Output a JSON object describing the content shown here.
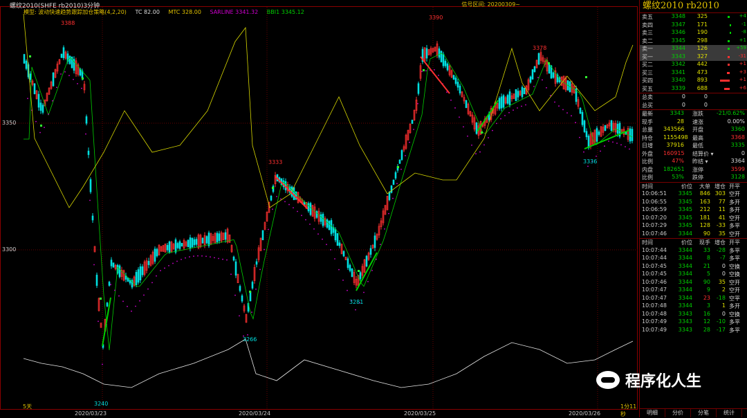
{
  "window_title": "螺纹2010(SHFE  rb2010)3分钟",
  "signal_range": "信号区间: 20200309~",
  "indicators": {
    "model": "模型: 波动快速趋势跟踪加仓策略(4,2,20)",
    "tc": "TC 82.00",
    "mtc": "MTC 328.00",
    "sarline": "SARLINE 3341.32",
    "bbi": "BBI1 3345.12"
  },
  "colors": {
    "up": "#ff3030",
    "down": "#00e0e0",
    "ma": "#00d000",
    "mtc": "#d8d800",
    "sar": "#d000d0",
    "vol": "#e8e8e8",
    "grid": "#6a0000"
  },
  "y_axis": [
    "3350",
    "3300"
  ],
  "x_axis": [
    "2020/03/23",
    "2020/03/24",
    "2020/03/25",
    "2020/03/26"
  ],
  "price_labels": [
    "3388",
    "3240",
    "3266",
    "3333",
    "3281",
    "3390",
    "3378",
    "3336"
  ],
  "bottom_left": "5天",
  "bottom_right": "1分11秒",
  "panel": {
    "title": "螺纹2010  rb2010",
    "orderbook": [
      {
        "label": "卖五",
        "price": "3348",
        "vol": "325",
        "chg": "+4",
        "bar": 3,
        "color": "#00d000",
        "hl": false
      },
      {
        "label": "卖四",
        "price": "3347",
        "vol": "171",
        "chg": "-1",
        "bar": 0,
        "color": "#00d000",
        "hl": false
      },
      {
        "label": "卖三",
        "price": "3346",
        "vol": "190",
        "chg": "-8",
        "bar": 0,
        "color": "#00d000",
        "hl": false
      },
      {
        "label": "卖二",
        "price": "3345",
        "vol": "298",
        "chg": "+1",
        "bar": 3,
        "color": "#00d000",
        "hl": false
      },
      {
        "label": "卖一",
        "price": "3344",
        "vol": "126",
        "chg": "+59",
        "bar": 3,
        "color": "#00d000",
        "hl": true
      },
      {
        "label": "买一",
        "price": "3343",
        "vol": "327",
        "chg": "-31",
        "bar": 3,
        "color": "#ff3030",
        "hl": true
      },
      {
        "label": "买二",
        "price": "3342",
        "vol": "442",
        "chg": "+1",
        "bar": 3,
        "color": "#ff3030",
        "hl": false
      },
      {
        "label": "买三",
        "price": "3341",
        "vol": "473",
        "chg": "+3",
        "bar": 4,
        "color": "#ff3030",
        "hl": false
      },
      {
        "label": "买四",
        "price": "3340",
        "vol": "893",
        "chg": "+1",
        "bar": 14,
        "color": "#ff3030",
        "hl": false
      },
      {
        "label": "买五",
        "price": "3339",
        "vol": "688",
        "chg": "+6",
        "bar": 8,
        "color": "#ff3030",
        "hl": false
      }
    ],
    "totals": [
      {
        "label": "总卖",
        "v1": "0",
        "v2": "0"
      },
      {
        "label": "总买",
        "v1": "0",
        "v2": "0"
      }
    ],
    "stats": [
      {
        "k1": "最新",
        "v1": "3343",
        "c1": "#00d000",
        "k2": "涨跌",
        "v2": "-21/0.62%",
        "c2": "#00d000"
      },
      {
        "k1": "现手",
        "v1": "28",
        "c1": "#e0e000",
        "k2": "速涨",
        "v2": "0.00%",
        "c2": "#ddd"
      },
      {
        "k1": "总量",
        "v1": "343566",
        "c1": "#e0e000",
        "k2": "开盘",
        "v2": "3360",
        "c2": "#00d000"
      },
      {
        "k1": "持仓",
        "v1": "1155498",
        "c1": "#e0e000",
        "k2": "最高",
        "v2": "3368",
        "c2": "#ff3030"
      },
      {
        "k1": "日增",
        "v1": "37916",
        "c1": "#e0e000",
        "k2": "最低",
        "v2": "3335",
        "c2": "#00d000"
      },
      {
        "k1": "外盘",
        "v1": "160915",
        "c1": "#ff3030",
        "k2": "结算价 ▾",
        "v2": "0",
        "c2": "#ddd"
      },
      {
        "k1": "比例",
        "v1": "47%",
        "c1": "#ff3030",
        "k2": "昨结 ▾",
        "v2": "3364",
        "c2": "#ddd"
      },
      {
        "k1": "内盘",
        "v1": "182651",
        "c1": "#00d000",
        "k2": "涨停",
        "v2": "3599",
        "c2": "#ff3030"
      },
      {
        "k1": "比例",
        "v1": "53%",
        "c1": "#00d000",
        "k2": "跌停",
        "v2": "3128",
        "c2": "#00d000"
      }
    ],
    "ticks1_header": [
      "时间",
      "价位",
      "大单",
      "增仓",
      "开平"
    ],
    "ticks1": [
      {
        "t": "10:06:51",
        "p": "3345",
        "v": "846",
        "d": "303",
        "n": "空开",
        "pc": "#00d000",
        "dc": "#e0e000"
      },
      {
        "t": "10:06:55",
        "p": "3345",
        "v": "163",
        "d": "77",
        "n": "多开",
        "pc": "#00d000",
        "dc": "#e0e000"
      },
      {
        "t": "10:06:59",
        "p": "3345",
        "v": "212",
        "d": "11",
        "n": "多开",
        "pc": "#00d000",
        "dc": "#e0e000"
      },
      {
        "t": "10:07:20",
        "p": "3345",
        "v": "181",
        "d": "41",
        "n": "空开",
        "pc": "#00d000",
        "dc": "#e0e000"
      },
      {
        "t": "10:07:29",
        "p": "3345",
        "v": "128",
        "d": "-33",
        "n": "多平",
        "pc": "#00d000",
        "dc": "#e0e000"
      },
      {
        "t": "10:07:46",
        "p": "3344",
        "v": "90",
        "d": "35",
        "n": "空开",
        "pc": "#00d000",
        "dc": "#e0e000"
      }
    ],
    "ticks2_header": [
      "时间",
      "价位",
      "现手",
      "增仓",
      "开平"
    ],
    "ticks2": [
      {
        "t": "10:07:44",
        "p": "3344",
        "v": "33",
        "d": "-28",
        "n": "多平",
        "pc": "#00d000",
        "vc": "#00d000"
      },
      {
        "t": "10:07:44",
        "p": "3344",
        "v": "8",
        "d": "-7",
        "n": "多平",
        "pc": "#00d000",
        "vc": "#00d000"
      },
      {
        "t": "10:07:45",
        "p": "3344",
        "v": "21",
        "d": "0",
        "n": "空换",
        "pc": "#00d000",
        "vc": "#00d000"
      },
      {
        "t": "10:07:45",
        "p": "3344",
        "v": "5",
        "d": "0",
        "n": "空换",
        "pc": "#00d000",
        "vc": "#00d000"
      },
      {
        "t": "10:07:46",
        "p": "3344",
        "v": "90",
        "d": "35",
        "n": "空开",
        "pc": "#00d000",
        "vc": "#00d000"
      },
      {
        "t": "10:07:47",
        "p": "3344",
        "v": "9",
        "d": "2",
        "n": "空开",
        "pc": "#00d000",
        "vc": "#00d000"
      },
      {
        "t": "10:07:47",
        "p": "3344",
        "v": "23",
        "d": "-18",
        "n": "空平",
        "pc": "#00d000",
        "vc": "#ff3030"
      },
      {
        "t": "10:07:48",
        "p": "3344",
        "v": "3",
        "d": "1",
        "n": "多开",
        "pc": "#00d000",
        "vc": "#00d000"
      },
      {
        "t": "10:07:48",
        "p": "3343",
        "v": "16",
        "d": "0",
        "n": "空换",
        "pc": "#00d000",
        "vc": "#00d000"
      },
      {
        "t": "10:07:49",
        "p": "3343",
        "v": "12",
        "d": "-10",
        "n": "多平",
        "pc": "#00d000",
        "vc": "#00d000"
      },
      {
        "t": "10:07:49",
        "p": "3343",
        "v": "28",
        "d": "-17",
        "n": "多平",
        "pc": "#00d000",
        "vc": "#00d000"
      }
    ],
    "tabs": [
      "明细",
      "分价",
      "分笔",
      "统计"
    ]
  },
  "watermark": "程序化人生"
}
